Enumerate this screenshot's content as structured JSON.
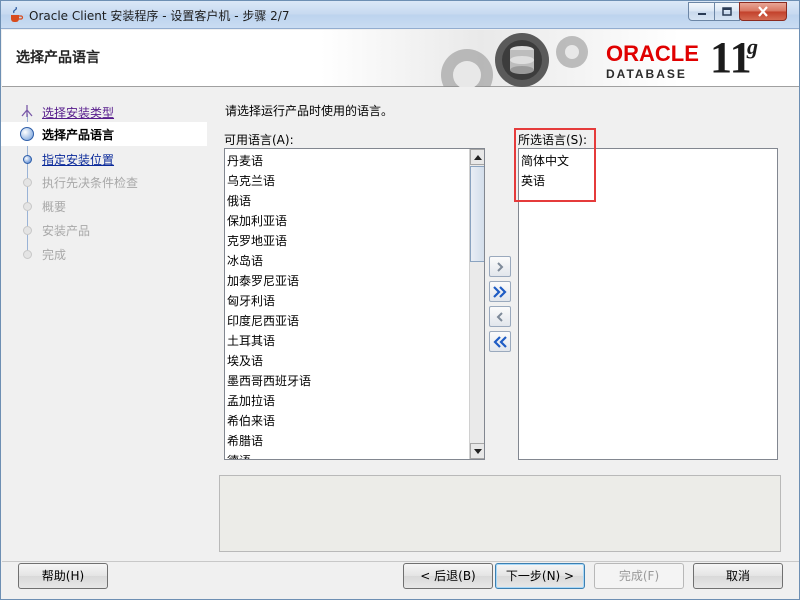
{
  "window": {
    "title": "Oracle Client 安装程序 - 设置客户机 - 步骤 2/7"
  },
  "header": {
    "page_title": "选择产品语言",
    "logo_text": "ORACLE",
    "logo_subtext": "DATABASE",
    "version_number": "11",
    "version_letter": "g"
  },
  "steps": [
    {
      "label": "选择安装类型",
      "state": "done"
    },
    {
      "label": "选择产品语言",
      "state": "current"
    },
    {
      "label": "指定安装位置",
      "state": "link"
    },
    {
      "label": "执行先决条件检查",
      "state": "disabled"
    },
    {
      "label": "概要",
      "state": "disabled"
    },
    {
      "label": "安装产品",
      "state": "disabled"
    },
    {
      "label": "完成",
      "state": "disabled"
    }
  ],
  "content": {
    "instruction": "请选择运行产品时使用的语言。",
    "available_label": "可用语言(A):",
    "selected_label": "所选语言(S):",
    "available_languages": [
      "丹麦语",
      "乌克兰语",
      "俄语",
      "保加利亚语",
      "克罗地亚语",
      "冰岛语",
      "加泰罗尼亚语",
      "匈牙利语",
      "印度尼西亚语",
      "土耳其语",
      "埃及语",
      "墨西哥西班牙语",
      "孟加拉语",
      "希伯来语",
      "希腊语",
      "德语"
    ],
    "selected_languages": [
      "简体中文",
      "英语"
    ]
  },
  "buttons": {
    "help": "帮助(H)",
    "back": "< 后退(B)",
    "next": "下一步(N) >",
    "finish": "完成(F)",
    "cancel": "取消"
  },
  "colors": {
    "oracle_red": "#e00000",
    "highlight_box": "#e53b3b"
  }
}
